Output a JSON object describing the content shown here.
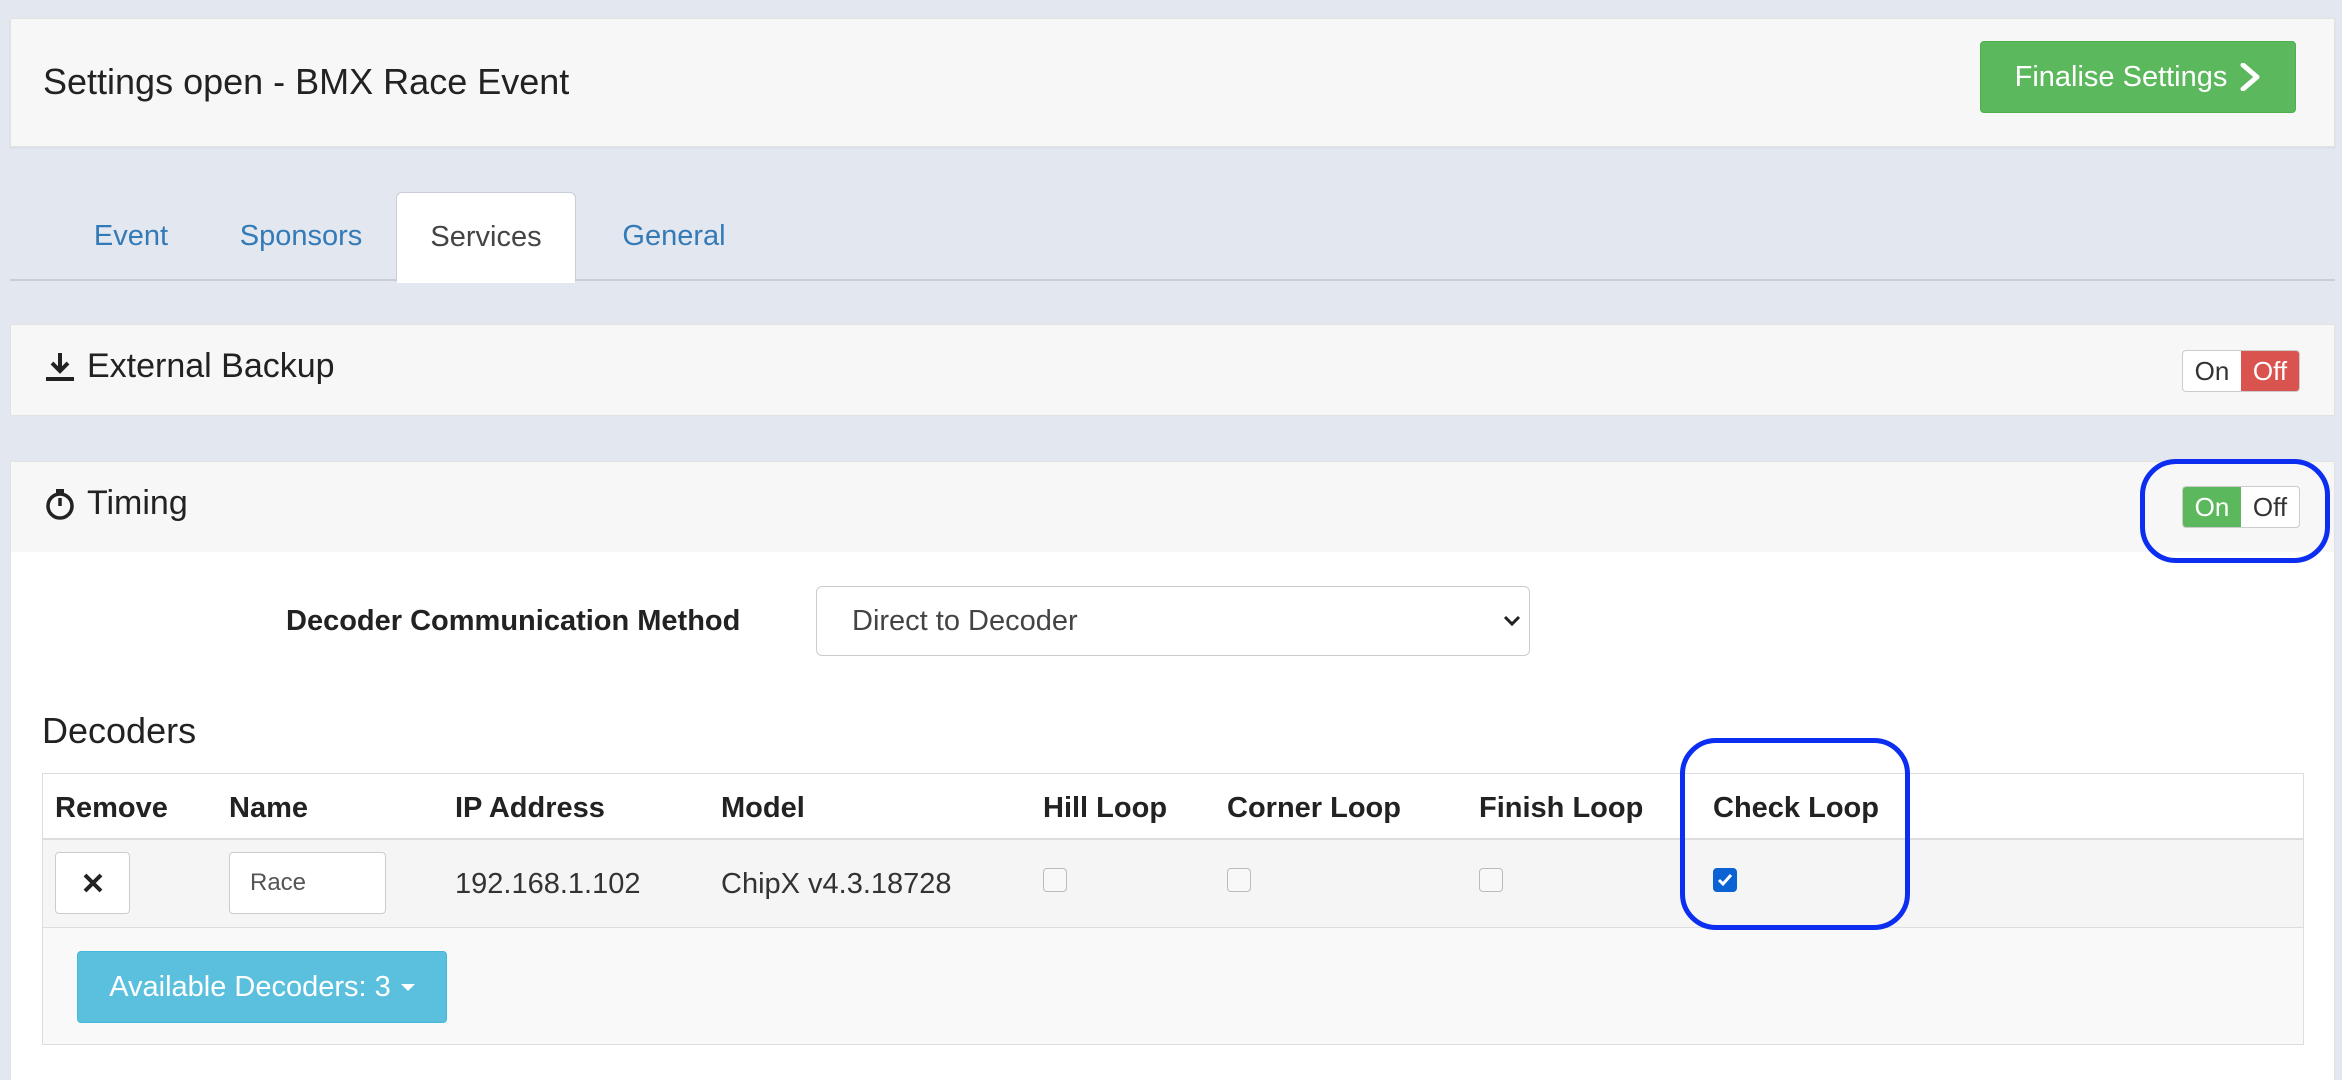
{
  "header": {
    "title": "Settings open - BMX Race Event",
    "finalise_label": "Finalise Settings"
  },
  "tabs": [
    {
      "label": "Event"
    },
    {
      "label": "Sponsors"
    },
    {
      "label": "Services",
      "active": true
    },
    {
      "label": "General"
    }
  ],
  "external_backup": {
    "title": "External Backup",
    "on_label": "On",
    "off_label": "Off",
    "state": "off"
  },
  "timing": {
    "title": "Timing",
    "on_label": "On",
    "off_label": "Off",
    "state": "on",
    "decoder_method_label": "Decoder Communication Method",
    "decoder_method_value": "Direct to Decoder"
  },
  "decoders": {
    "title": "Decoders",
    "columns": [
      "Remove",
      "Name",
      "IP Address",
      "Model",
      "Hill Loop",
      "Corner Loop",
      "Finish Loop",
      "Check Loop"
    ],
    "rows": [
      {
        "name": "Race",
        "ip": "192.168.1.102",
        "model": "ChipX v4.3.18728",
        "hill_loop": false,
        "corner_loop": false,
        "finish_loop": false,
        "check_loop": true
      }
    ],
    "available_label": "Available Decoders: 3"
  },
  "colors": {
    "success": "#5cb85c",
    "danger": "#d9534f",
    "info": "#5bc0de",
    "link": "#337ab7",
    "highlight": "#0b2ef0"
  }
}
